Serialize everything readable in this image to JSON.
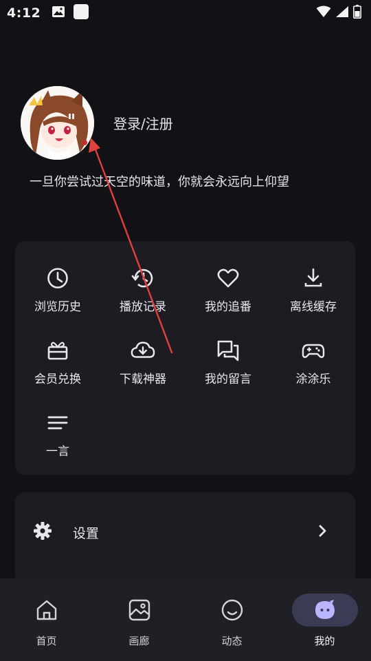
{
  "status_bar": {
    "time": "4:12",
    "left_icons": [
      "image-icon",
      "app-icon"
    ],
    "right_icons": [
      "wifi-icon",
      "signal-icon",
      "battery-icon"
    ]
  },
  "profile": {
    "login_label": "登录/注册",
    "motto": "一旦你尝试过天空的味道，你就会永远向上仰望"
  },
  "features": [
    {
      "label": "浏览历史",
      "icon": "clock-icon"
    },
    {
      "label": "播放记录",
      "icon": "history-icon"
    },
    {
      "label": "我的追番",
      "icon": "heart-icon"
    },
    {
      "label": "离线缓存",
      "icon": "download-icon"
    },
    {
      "label": "会员兑换",
      "icon": "gift-icon"
    },
    {
      "label": "下载神器",
      "icon": "cloud-download-icon"
    },
    {
      "label": "我的留言",
      "icon": "chat-icon"
    },
    {
      "label": "涂涂乐",
      "icon": "gamepad-icon"
    },
    {
      "label": "一言",
      "icon": "lines-icon"
    }
  ],
  "settings": {
    "label": "设置",
    "icon": "gear-icon"
  },
  "bottom_nav": [
    {
      "label": "首页",
      "icon": "home-icon",
      "active": false
    },
    {
      "label": "画廊",
      "icon": "gallery-icon",
      "active": false
    },
    {
      "label": "动态",
      "icon": "smiley-icon",
      "active": false
    },
    {
      "label": "我的",
      "icon": "mascot-icon",
      "active": true
    }
  ],
  "colors": {
    "background": "#111116",
    "card": "#1c1c22",
    "nav_bar": "#1f1f26",
    "nav_active_pill": "#3b3b56",
    "nav_active_icon": "#b9b6ff",
    "annotation_arrow": "#e0413f",
    "avatar_ring": "#c72f2f"
  }
}
